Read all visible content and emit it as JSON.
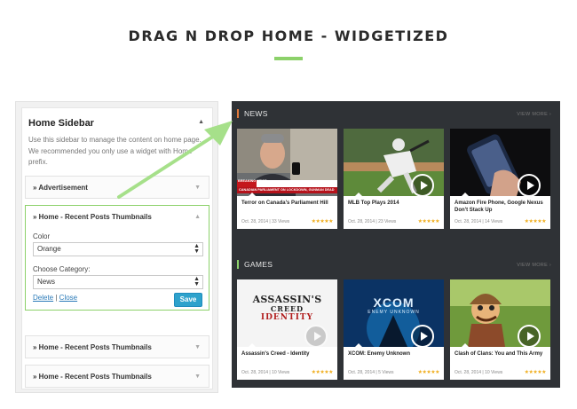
{
  "page": {
    "title": "DRAG N DROP HOME - WIDGETIZED"
  },
  "sidebar": {
    "title": "Home Sidebar",
    "description": "Use this sidebar to manage the content on home page. We recommended you only use a widget with Home prefix.",
    "widgets": [
      {
        "title": "» Advertisement"
      },
      {
        "title": "» Home - Recent Posts Thumbnails",
        "color_label": "Color",
        "color_value": "Orange",
        "category_label": "Choose Category:",
        "category_value": "News",
        "delete_label": "Delete",
        "separator": "|",
        "close_label": "Close",
        "save_label": "Save"
      },
      {
        "title": "» Home - Recent Posts Thumbnails"
      },
      {
        "title": "» Home - Recent Posts Thumbnails"
      }
    ]
  },
  "preview": {
    "sections": [
      {
        "title": "NEWS",
        "accent": "#e0783c",
        "view_more": "VIEW MORE ›",
        "posts": [
          {
            "title": "Terror on Canada's Parliament Hill",
            "date": "Oct. 28, 2014",
            "views": "33 Views",
            "stars": "★★★★★",
            "overlay": "BREAKING NEWS",
            "ticker": "CANADIAN PARLIAMENT ON LOCKDOWN, GUNMAN DEAD"
          },
          {
            "title": "MLB Top Plays 2014",
            "date": "Oct. 28, 2014",
            "views": "23 Views",
            "stars": "★★★★★"
          },
          {
            "title": "Amazon Fire Phone, Google Nexus Don't Stack Up",
            "date": "Oct. 28, 2014",
            "views": "14 Views",
            "stars": "★★★★★"
          }
        ]
      },
      {
        "title": "GAMES",
        "accent": "#8cd16a",
        "view_more": "VIEW MORE ›",
        "posts": [
          {
            "title": "Assassin's Creed - Identity",
            "date": "Oct. 28, 2014",
            "views": "10 Views",
            "stars": "★★★★★",
            "logo_line1": "ASSASSIN'S",
            "logo_line2": "CREED",
            "logo_line3": "IDENTITY"
          },
          {
            "title": "XCOM: Enemy Unknown",
            "date": "Oct. 28, 2014",
            "views": "5 Views",
            "stars": "★★★★★",
            "logo_line1": "XCOM",
            "logo_line2": "ENEMY UNKNOWN"
          },
          {
            "title": "Clash of Clans: You and This Army",
            "date": "Oct. 28, 2014",
            "views": "10 Views",
            "stars": "★★★★★"
          }
        ]
      }
    ]
  },
  "colors": {
    "accent_green": "#8cd16a",
    "save_blue": "#2ea2cc",
    "dark_bg": "#2f3236",
    "star": "#f0ad1c"
  }
}
